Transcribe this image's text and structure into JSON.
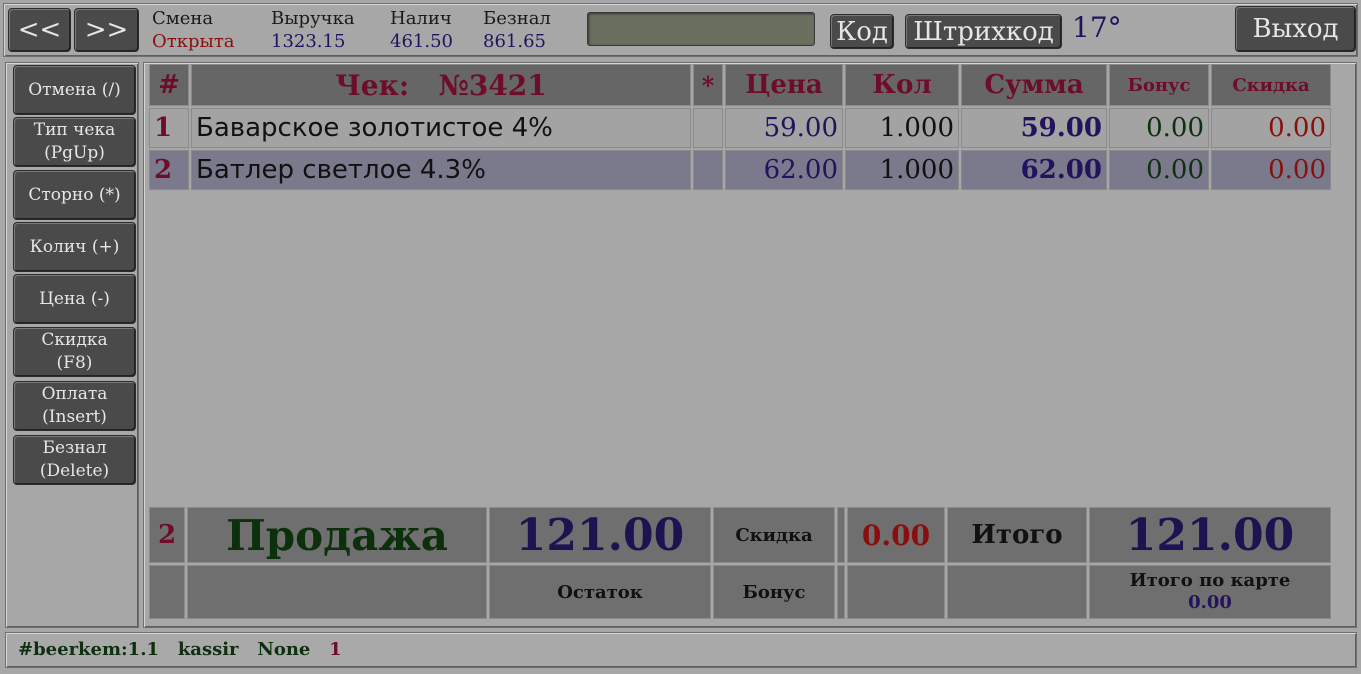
{
  "nav": {
    "back_label": "<<",
    "forward_label": ">>"
  },
  "stats": [
    {
      "label": "Смена",
      "value": "Открыта",
      "value_color": "#8a0e0e"
    },
    {
      "label": "Выручка",
      "value": "1323.15",
      "value_color": "#23135e"
    },
    {
      "label": "Налич",
      "value": "461.50",
      "value_color": "#23135e"
    },
    {
      "label": "Безнал",
      "value": "861.65",
      "value_color": "#23135e"
    }
  ],
  "toolbar": {
    "input_value": "",
    "code_label": "Код",
    "barcode_label": "Штрихкод",
    "temperature": "17°",
    "exit_label": "Выход"
  },
  "sidebar": {
    "items": [
      {
        "line1": "Отмена (/)",
        "line2": ""
      },
      {
        "line1": "Тип чека",
        "line2": "(PgUp)"
      },
      {
        "line1": "Сторно (*)",
        "line2": ""
      },
      {
        "line1": "Колич (+)",
        "line2": ""
      },
      {
        "line1": "Цена (-)",
        "line2": ""
      },
      {
        "line1": "Скидка",
        "line2": "(F8)"
      },
      {
        "line1": "Оплата",
        "line2": "(Insert)"
      },
      {
        "line1": "Безнал",
        "line2": "(Delete)"
      }
    ]
  },
  "receipt": {
    "columns": {
      "num": "#",
      "check_label": "Чек:",
      "check_number": "№3421",
      "star": "*",
      "price": "Цена",
      "qty": "Кол",
      "sum": "Сумма",
      "bonus": "Бонус",
      "discount": "Скидка"
    },
    "rows": [
      {
        "num": "1",
        "name": "Баварское золотистое 4%",
        "star": "",
        "price": "59.00",
        "qty": "1.000",
        "sum": "59.00",
        "bonus": "0.00",
        "discount": "0.00"
      },
      {
        "num": "2",
        "name": "Батлер светлое 4.3%",
        "star": "",
        "price": "62.00",
        "qty": "1.000",
        "sum": "62.00",
        "bonus": "0.00",
        "discount": "0.00"
      }
    ]
  },
  "summary": {
    "count": "2",
    "mode": "Продажа",
    "amount": "121.00",
    "discount_label": "Скидка",
    "discount_value": "0.00",
    "total_label": "Итого",
    "total_value": "121.00",
    "remainder_label": "Остаток",
    "bonus_label": "Бонус",
    "card_total_label": "Итого по карте",
    "card_total_value": "0.00"
  },
  "status_bar": {
    "terminal": "#beerkem:1.1",
    "user": "kassir",
    "extra": "None",
    "counter": "1"
  }
}
